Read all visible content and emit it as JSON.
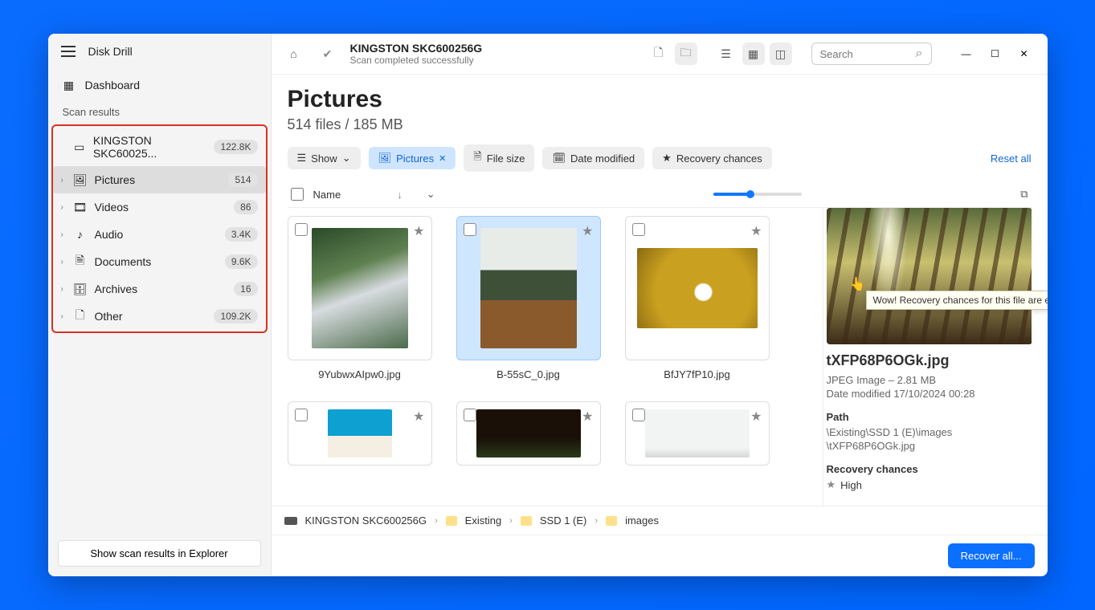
{
  "app_name": "Disk Drill",
  "sidebar": {
    "dashboard": "Dashboard",
    "scan_results_heading": "Scan results",
    "drive": {
      "label": "KINGSTON SKC60025...",
      "count": "122.8K"
    },
    "categories": [
      {
        "label": "Pictures",
        "count": "514"
      },
      {
        "label": "Videos",
        "count": "86"
      },
      {
        "label": "Audio",
        "count": "3.4K"
      },
      {
        "label": "Documents",
        "count": "9.6K"
      },
      {
        "label": "Archives",
        "count": "16"
      },
      {
        "label": "Other",
        "count": "109.2K"
      }
    ],
    "explorer_button": "Show scan results in Explorer"
  },
  "titlebar": {
    "title": "KINGSTON SKC600256G",
    "subtitle": "Scan completed successfully",
    "search_placeholder": "Search"
  },
  "page": {
    "title": "Pictures",
    "subtitle": "514 files / 185 MB",
    "show_label": "Show",
    "filters": {
      "pictures": "Pictures",
      "file_size": "File size",
      "date_modified": "Date modified",
      "recovery_chances": "Recovery chances"
    },
    "reset": "Reset all",
    "name_col": "Name"
  },
  "tooltip": "Wow! Recovery chances for this file are excellent!",
  "grid": [
    {
      "name": "9YubwxAIpw0.jpg"
    },
    {
      "name": "B-55sC_0.jpg"
    },
    {
      "name": "BfJY7fP10.jpg"
    },
    {
      "name": ""
    },
    {
      "name": ""
    },
    {
      "name": ""
    }
  ],
  "preview": {
    "filename": "tXFP68P6OGk.jpg",
    "type_size": "JPEG Image – 2.81 MB",
    "date_modified": "Date modified 17/10/2024 00:28",
    "path_heading": "Path",
    "path_line1": "\\Existing\\SSD 1 (E)\\images",
    "path_line2": "\\tXFP68P6OGk.jpg",
    "recovery_heading": "Recovery chances",
    "recovery_value": "High"
  },
  "breadcrumb": {
    "drive": "KINGSTON SKC600256G",
    "p1": "Existing",
    "p2": "SSD 1 (E)",
    "p3": "images"
  },
  "footer": {
    "recover": "Recover all..."
  }
}
